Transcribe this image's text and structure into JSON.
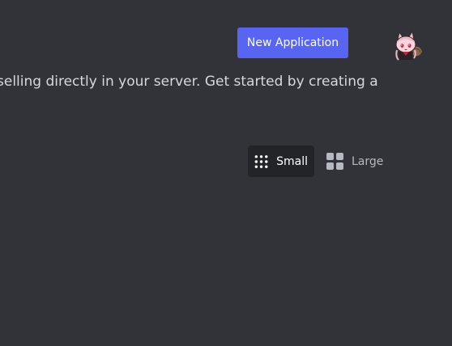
{
  "header": {
    "new_application_label": "New Application"
  },
  "intro": {
    "text": "selling directly in your server. Get started by creating a"
  },
  "view_toggle": {
    "small_label": "Small",
    "large_label": "Large",
    "selected": "Small"
  },
  "colors": {
    "background": "#313338",
    "accent": "#5865f2",
    "active_toggle_bg": "#232428",
    "muted_text": "#b5bac1"
  },
  "icons": {
    "small": "grid-small-icon",
    "large": "grid-large-icon",
    "avatar": "avatar"
  }
}
